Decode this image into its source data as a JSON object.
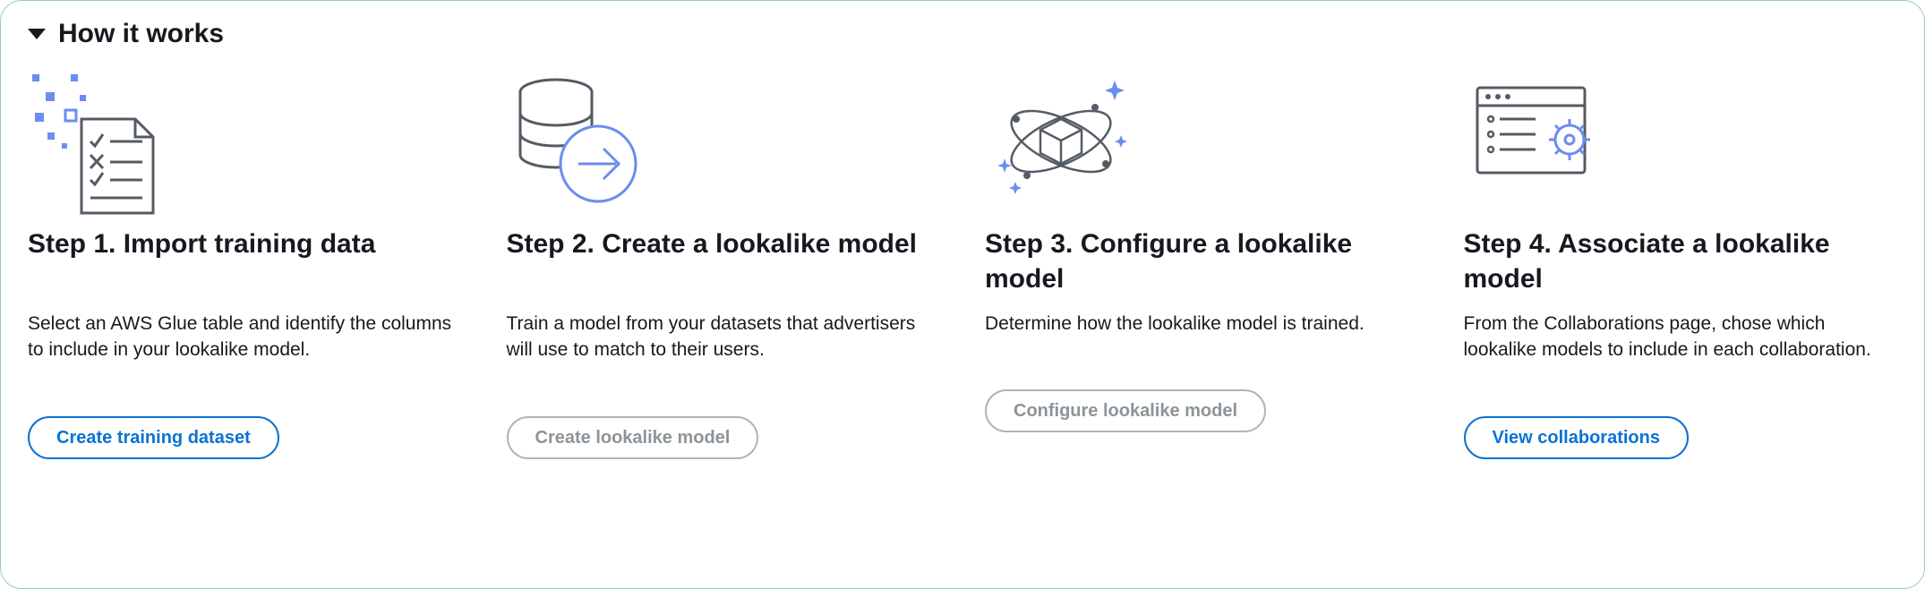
{
  "header": {
    "title": "How it works"
  },
  "steps": [
    {
      "title": "Step 1. Import training data",
      "description": "Select an AWS Glue table and identify the columns to include in your lookalike model.",
      "button_label": "Create training dataset",
      "button_enabled": true
    },
    {
      "title": "Step 2. Create a lookalike model",
      "description": "Train a model from your datasets that advertisers will use to match to their users.",
      "button_label": "Create lookalike model",
      "button_enabled": false
    },
    {
      "title": "Step 3. Configure a lookalike model",
      "description": "Determine how the lookalike model is trained.",
      "button_label": "Configure lookalike model",
      "button_enabled": false
    },
    {
      "title": "Step 4. Associate a lookalike model",
      "description": "From the Collaborations page, chose which lookalike models to include in each collaboration.",
      "button_label": "View collaborations",
      "button_enabled": true
    }
  ],
  "colors": {
    "accent": "#0972d3",
    "icon_gray": "#545b64",
    "icon_accent": "#6b8df0",
    "disabled": "#aab7b8"
  }
}
